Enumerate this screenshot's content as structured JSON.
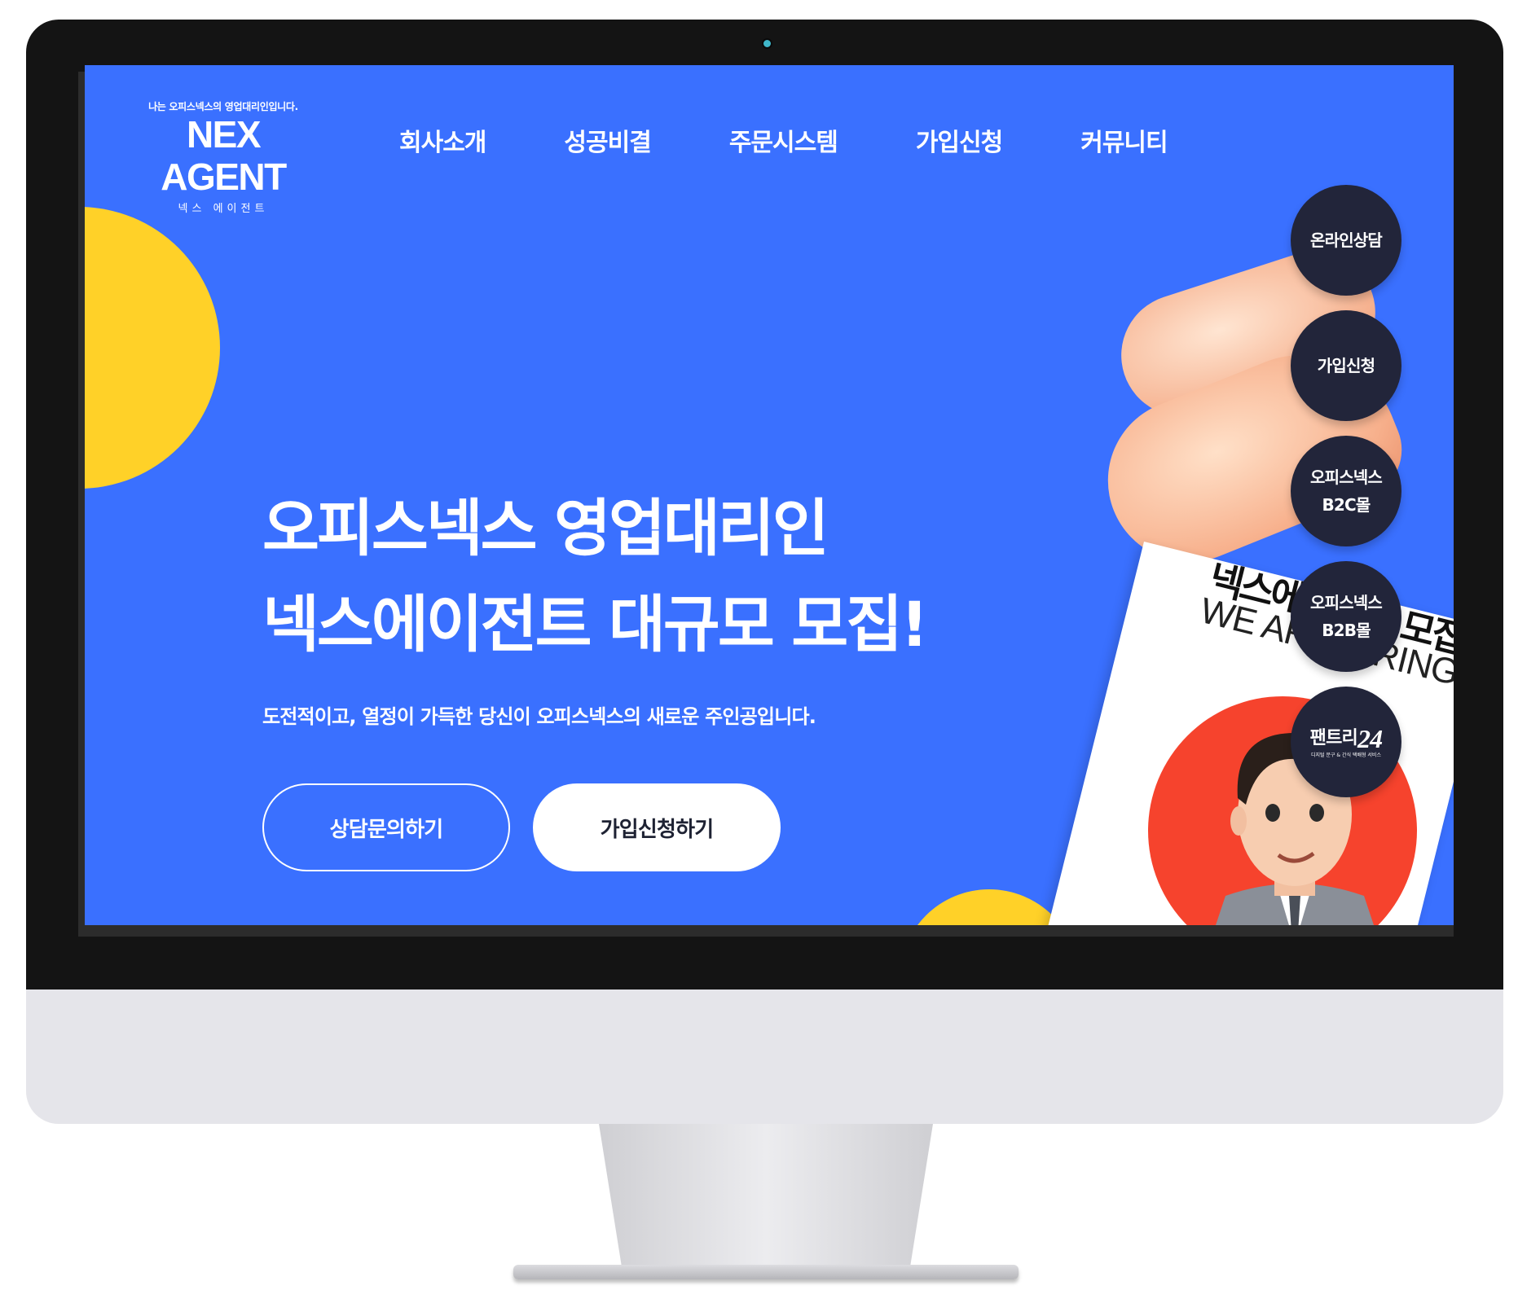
{
  "logo": {
    "tagline": "나는 오피스넥스의 영업대리인입니다.",
    "main": "NEX AGENT",
    "sub": "넥스 에이전트"
  },
  "nav": {
    "items": [
      "회사소개",
      "성공비결",
      "주문시스템",
      "가입신청",
      "커뮤니티"
    ]
  },
  "hero": {
    "title_line1": "오피스넥스 영업대리인",
    "title_line2": "넥스에이전트 대규모 모집!",
    "description": "도전적이고, 열정이 가득한 당신이 오피스넥스의 새로운 주인공입니다.",
    "consult_button": "상담문의하기",
    "signup_button": "가입신청하기"
  },
  "card": {
    "headline": "넥스에이전트 모집",
    "subline": "WE ARE HIRING"
  },
  "floating": {
    "online_consult": "온라인상담",
    "signup": "가입신청",
    "b2c_line1": "오피스넥스",
    "b2c_line2": "B2C몰",
    "b2b_line1": "오피스넥스",
    "b2b_line2": "B2B몰",
    "pantry_name": "팬트리",
    "pantry_number": "24",
    "pantry_tagline": "디지털 문구 & 간식 택배형 서비스"
  },
  "colors": {
    "screen_bg": "#3a70ff",
    "accent_yellow": "#ffd128",
    "float_btn_bg": "#22253a",
    "red_circle": "#f6432d"
  }
}
